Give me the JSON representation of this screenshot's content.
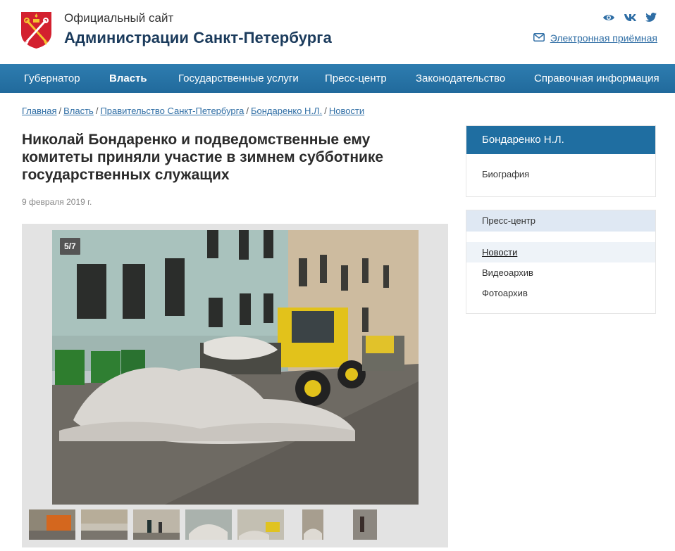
{
  "header": {
    "subtitle": "Официальный сайт",
    "title": "Администрации Санкт-Петербурга",
    "reception_label": "Электронная приёмная",
    "social_icons": [
      "eye-icon",
      "vk-icon",
      "twitter-icon"
    ],
    "accent_color": "#2f6ea5"
  },
  "nav": {
    "items": [
      {
        "label": "Губернатор"
      },
      {
        "label": "Власть"
      },
      {
        "label": "Государственные услуги"
      },
      {
        "label": "Пресс-центр"
      },
      {
        "label": "Законодательство"
      },
      {
        "label": "Справочная информация"
      }
    ],
    "active_label": "Власть",
    "color": "#216a9c"
  },
  "breadcrumb": {
    "items": [
      "Главная",
      "Власть",
      "Правительство Санкт-Петербурга",
      "Бондаренко Н.Л.",
      "Новости"
    ],
    "separator": "/"
  },
  "article": {
    "title": "Николай Бондаренко и подведомственные ему комитеты приняли участие в зимнем субботнике государственных служащих",
    "date": "9 февраля 2019 г."
  },
  "gallery": {
    "counter": "5/7",
    "thumbnail_count": 7
  },
  "sidebar": {
    "person_block": {
      "heading": "Бондаренко Н.Л.",
      "links": [
        "Биография"
      ]
    },
    "press_block": {
      "heading": "Пресс-центр",
      "links": [
        "Новости",
        "Видеоархив",
        "Фотоархив"
      ],
      "active": "Новости"
    }
  }
}
